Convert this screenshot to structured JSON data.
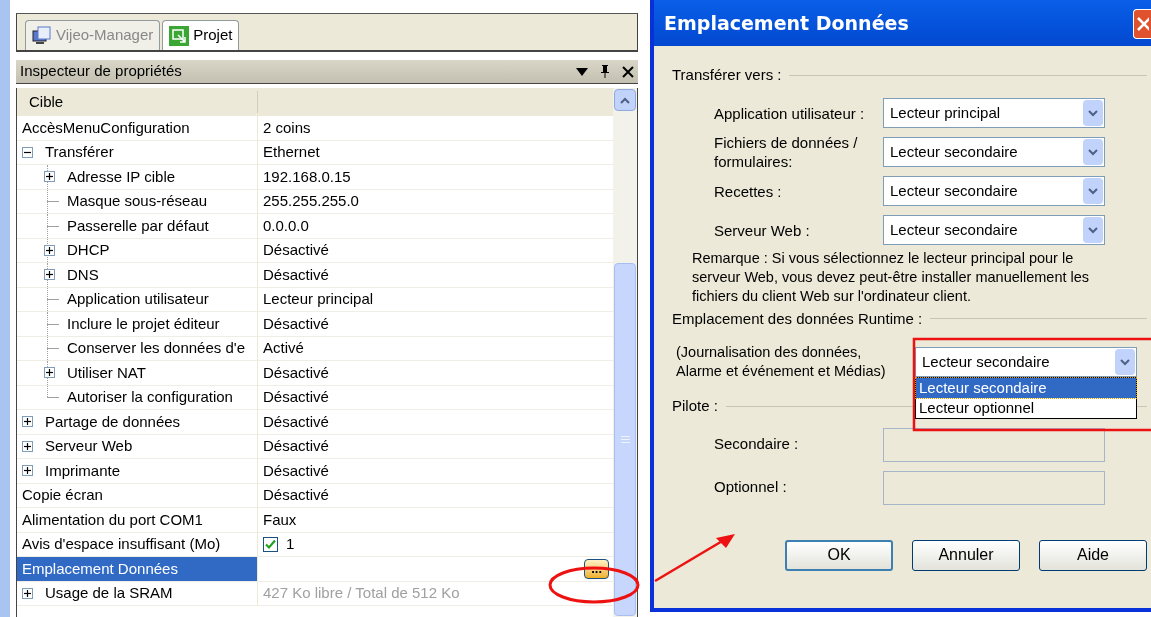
{
  "tabs": [
    {
      "label": "Vijeo-Manager",
      "selected": false
    },
    {
      "label": "Projet",
      "selected": true
    }
  ],
  "inspector": {
    "title": "Inspecteur de propriétés",
    "category": "Cible",
    "rows": [
      {
        "name": "AccèsMenuConfiguration",
        "value": "2 coins",
        "kind": "text",
        "selected": false
      },
      {
        "name": "Transférer",
        "value": "Ethernet",
        "kind": "text",
        "selected": false,
        "expanded": true,
        "children": [
          {
            "name": "Adresse IP cible",
            "value": "192.168.0.15",
            "kind": "text",
            "selected": false,
            "expanded": false
          },
          {
            "name": "Masque sous-réseau",
            "value": "255.255.255.0",
            "kind": "text",
            "selected": false
          },
          {
            "name": "Passerelle par défaut",
            "value": "0.0.0.0",
            "kind": "text",
            "selected": false
          },
          {
            "name": "DHCP",
            "value": "Désactivé",
            "kind": "text",
            "selected": false,
            "expanded": false
          },
          {
            "name": "DNS",
            "value": "Désactivé",
            "kind": "text",
            "selected": false,
            "expanded": false
          },
          {
            "name": "Application utilisateur",
            "value": "Lecteur principal",
            "kind": "text",
            "selected": false
          },
          {
            "name": "Inclure le projet éditeur",
            "value": "Désactivé",
            "kind": "text",
            "selected": false
          },
          {
            "name": "Conserver les données d'e",
            "value": "Activé",
            "kind": "text",
            "selected": false
          },
          {
            "name": "Utiliser NAT",
            "value": "Désactivé",
            "kind": "text",
            "selected": false,
            "expanded": false
          },
          {
            "name": "Autoriser la configuration",
            "value": "Désactivé",
            "kind": "text",
            "selected": false
          }
        ]
      },
      {
        "name": "Partage de données",
        "value": "Désactivé",
        "kind": "text",
        "selected": false,
        "expanded": false
      },
      {
        "name": "Serveur Web",
        "value": "Désactivé",
        "kind": "text",
        "selected": false,
        "expanded": false
      },
      {
        "name": "Imprimante",
        "value": "Désactivé",
        "kind": "text",
        "selected": false,
        "expanded": false
      },
      {
        "name": "Copie écran",
        "value": "Désactivé",
        "kind": "text",
        "selected": false
      },
      {
        "name": "Alimentation du port COM1",
        "value": "Faux",
        "kind": "text",
        "selected": false
      },
      {
        "name": "Avis d'espace insuffisant (Mo)",
        "value": "1",
        "kind": "checkbox",
        "checked": true,
        "selected": false
      },
      {
        "name": "Emplacement Données",
        "kind": "browse",
        "button": "...",
        "selected": true
      },
      {
        "name": "Usage de la SRAM",
        "value": "427 Ko libre / Total de 512 Ko",
        "kind": "readonly",
        "selected": false,
        "expanded": false
      }
    ]
  },
  "dialog": {
    "title": "Emplacement Données",
    "transfer_section": "Transférer vers :",
    "transfer_rows": [
      {
        "label": "Application utilisateur :",
        "value": "Lecteur principal"
      },
      {
        "label": "Fichiers de données /\nformulaires:",
        "value": "Lecteur secondaire"
      },
      {
        "label": "Recettes :",
        "value": "Lecteur secondaire"
      },
      {
        "label": "Serveur Web :",
        "value": "Lecteur secondaire"
      }
    ],
    "note": "Remarque : Si vous sélectionnez le lecteur principal pour le\nserveur Web, vous devez peut-être installer manuellement les\nfichiers du client Web sur l'ordinateur client.",
    "runtime_section": "Emplacement des données Runtime :",
    "runtime_label": "(Journalisation des données,\nAlarme et événement et Médias)",
    "runtime_value": "Lecteur secondaire",
    "runtime_options": [
      {
        "label": "Lecteur secondaire",
        "selected": true
      },
      {
        "label": "Lecteur optionnel",
        "selected": false
      }
    ],
    "driver_section": "Pilote :",
    "driver_fields": [
      {
        "label": "Secondaire :",
        "disabled": true
      },
      {
        "label": "Optionnel :",
        "disabled": true
      }
    ],
    "buttons": [
      {
        "label": "OK",
        "default": true
      },
      {
        "label": "Annuler",
        "default": false
      },
      {
        "label": "Aide",
        "default": false
      }
    ]
  }
}
